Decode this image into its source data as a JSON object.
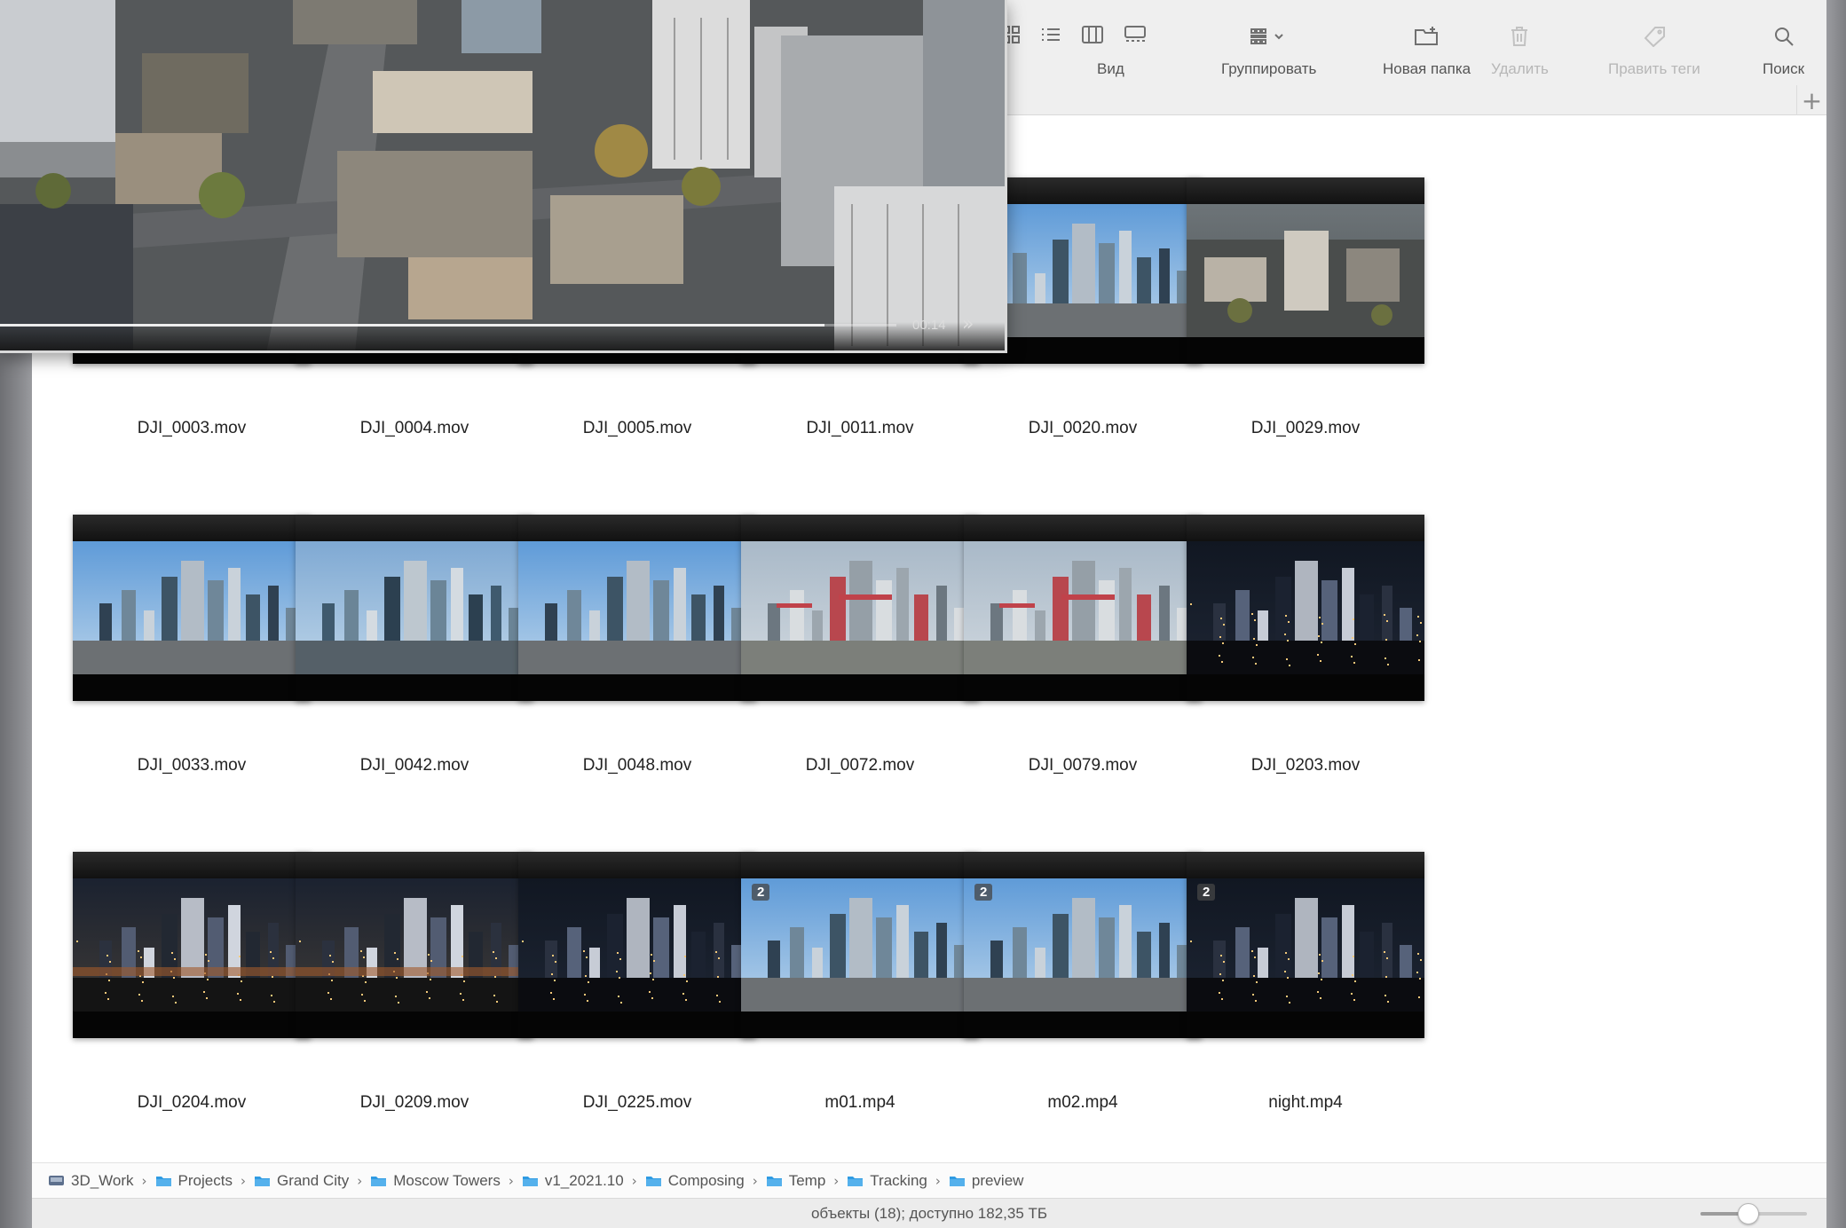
{
  "toolbar": {
    "view_label": "Вид",
    "group_label": "Группировать",
    "new_folder_label": "Новая папка",
    "delete_label": "Удалить",
    "tags_label": "Править теги",
    "search_label": "Поиск"
  },
  "files": [
    {
      "name": "DJI_0003.mov",
      "scene": "aerial"
    },
    {
      "name": "DJI_0004.mov",
      "scene": "aerial"
    },
    {
      "name": "DJI_0005.mov",
      "scene": "aerial"
    },
    {
      "name": "DJI_0011.mov",
      "scene": "day"
    },
    {
      "name": "DJI_0020.mov",
      "scene": "day"
    },
    {
      "name": "DJI_0029.mov",
      "scene": "aerial"
    },
    {
      "name": "DJI_0033.mov",
      "scene": "day"
    },
    {
      "name": "DJI_0042.mov",
      "scene": "glass"
    },
    {
      "name": "DJI_0048.mov",
      "scene": "day"
    },
    {
      "name": "DJI_0072.mov",
      "scene": "construction"
    },
    {
      "name": "DJI_0079.mov",
      "scene": "construction"
    },
    {
      "name": "DJI_0203.mov",
      "scene": "night"
    },
    {
      "name": "DJI_0204.mov",
      "scene": "dusk"
    },
    {
      "name": "DJI_0209.mov",
      "scene": "dusk"
    },
    {
      "name": "DJI_0225.mov",
      "scene": "night"
    },
    {
      "name": "m01.mp4",
      "scene": "day",
      "badge": "2"
    },
    {
      "name": "m02.mp4",
      "scene": "day",
      "badge": "2"
    },
    {
      "name": "night.mp4",
      "scene": "night",
      "badge": "2"
    }
  ],
  "path": [
    "3D_Work",
    "Projects",
    "Grand City",
    "Moscow Towers",
    "v1_2021.10",
    "Composing",
    "Temp",
    "Tracking",
    "preview"
  ],
  "status": "объекты (18); доступно 182,35 ТБ",
  "preview": {
    "time": "00:14",
    "progress": 0.92
  },
  "zoom_level": 0.45,
  "colors": {
    "folder": "#2f9be3",
    "disk": "#5c6f8c"
  }
}
